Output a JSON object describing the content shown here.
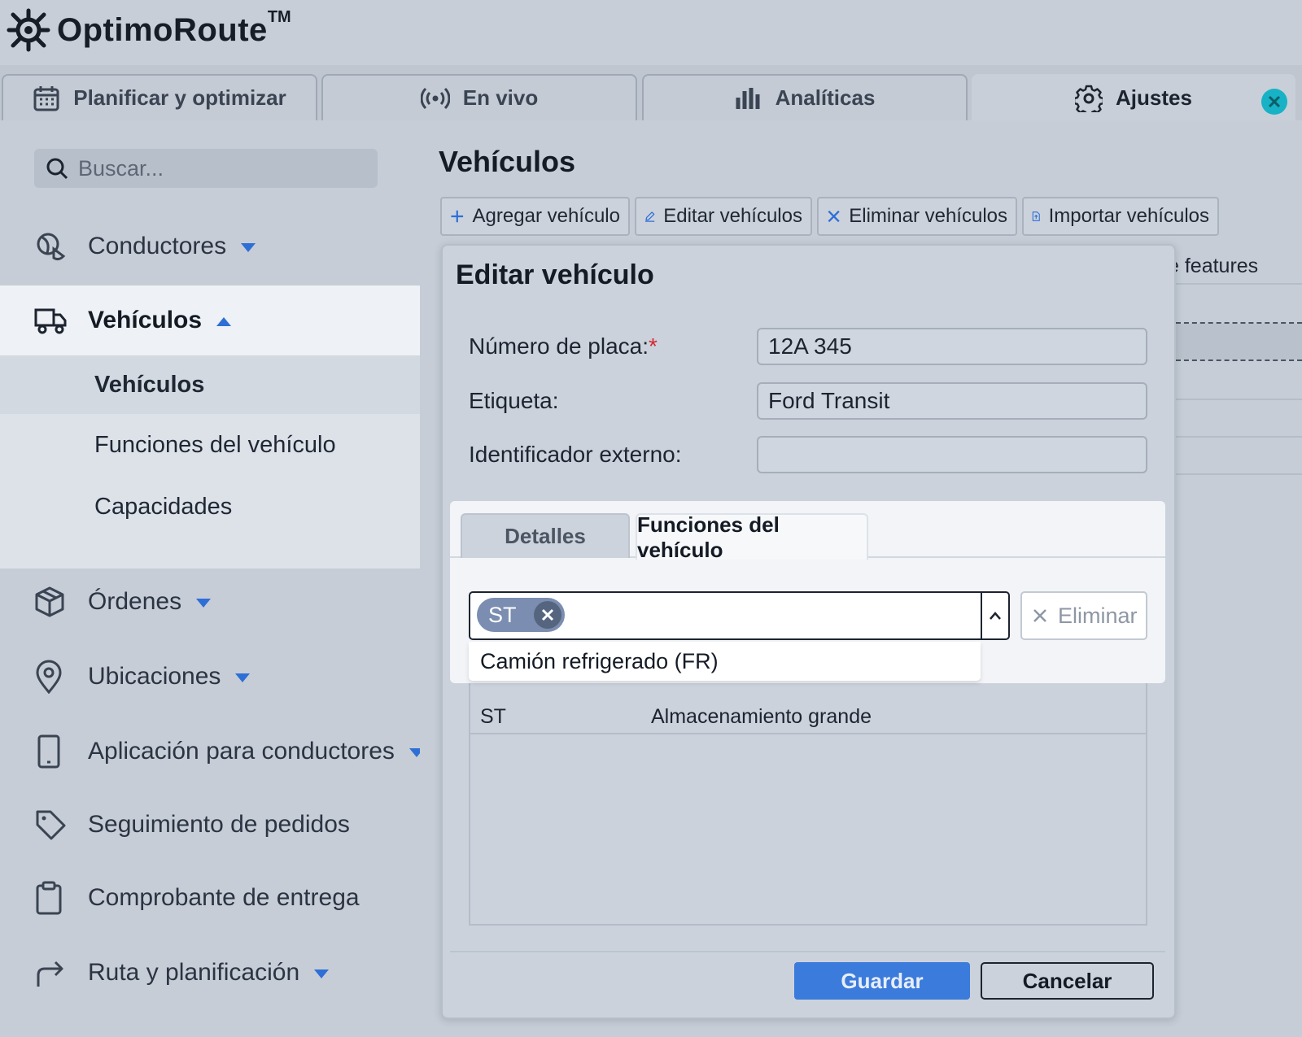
{
  "app": {
    "name": "OptimoRoute",
    "trademark": "TM"
  },
  "tabs": [
    {
      "label": "Planificar y optimizar",
      "icon": "calendar-icon"
    },
    {
      "label": "En vivo",
      "icon": "broadcast-icon"
    },
    {
      "label": "Analíticas",
      "icon": "bar-chart-icon"
    },
    {
      "label": "Ajustes",
      "icon": "gear-icon",
      "active": true
    }
  ],
  "sidebar": {
    "search_placeholder": "Buscar...",
    "items": [
      {
        "label": "Conductores",
        "icon": "driver-icon"
      },
      {
        "label": "Vehículos",
        "icon": "truck-icon",
        "expanded": true
      },
      {
        "label": "Órdenes",
        "icon": "package-icon"
      },
      {
        "label": "Ubicaciones",
        "icon": "location-pin-icon"
      },
      {
        "label": "Aplicación para conductores",
        "icon": "mobile-icon"
      },
      {
        "label": "Seguimiento de pedidos",
        "icon": "tag-icon"
      },
      {
        "label": "Comprobante de entrega",
        "icon": "clipboard-icon"
      },
      {
        "label": "Ruta y planificación",
        "icon": "route-arrow-icon"
      }
    ],
    "subitems": [
      "Vehículos",
      "Funciones del vehículo",
      "Capacidades"
    ]
  },
  "main": {
    "title": "Vehículos",
    "toolbar": {
      "add": "Agregar vehículo",
      "edit": "Editar vehículos",
      "delete": "Eliminar vehículos",
      "import": "Importar vehículos"
    },
    "background_header_fragment": "e features"
  },
  "modal": {
    "title": "Editar vehículo",
    "fields": {
      "plate_label": "Número de placa:",
      "plate_required": "*",
      "plate_value": "12A 345",
      "tag_label": "Etiqueta:",
      "tag_value": "Ford Transit",
      "external_label": "Identificador externo:",
      "external_value": ""
    },
    "tabs": {
      "details": "Detalles",
      "features": "Funciones del vehículo"
    },
    "selected_chip": "ST",
    "remove_label": "Eliminar",
    "dropdown_option": "Camión refrigerado (FR)",
    "table_rows": [
      {
        "code": "ST",
        "name": "Almacenamiento grande"
      }
    ],
    "save_label": "Guardar",
    "cancel_label": "Cancelar"
  },
  "colors": {
    "accent": "#2e6fd6",
    "primary_button": "#3b7bdb",
    "close_badge": "#17b2c5",
    "required": "#d7262e"
  }
}
